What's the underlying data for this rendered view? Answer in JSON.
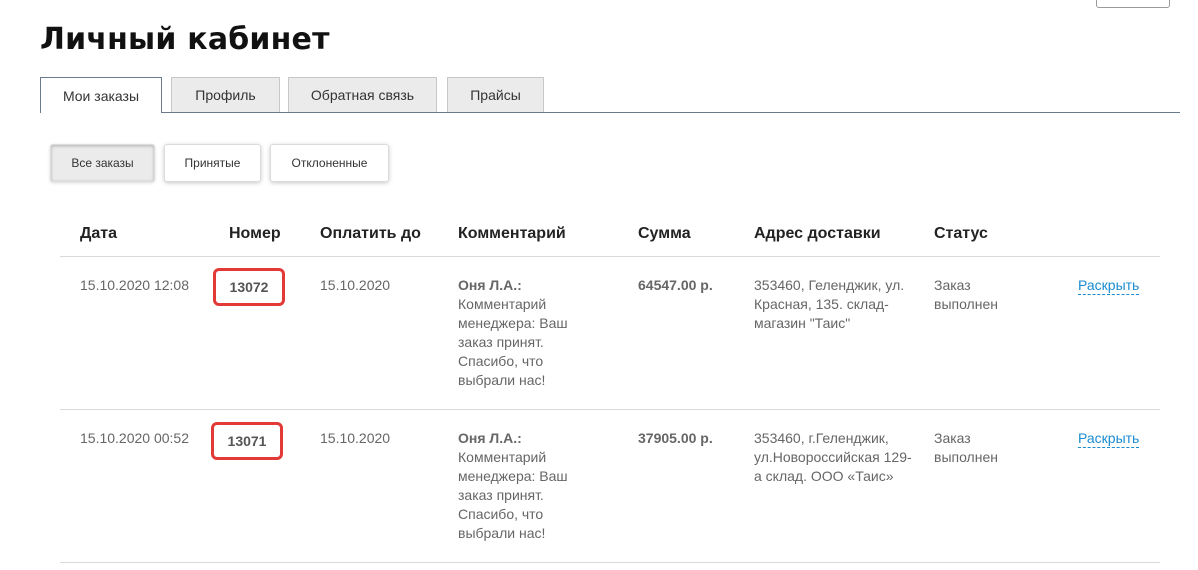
{
  "page": {
    "title": "Личный кабинет"
  },
  "tabs": [
    {
      "label": "Мои заказы",
      "active": true
    },
    {
      "label": "Профиль",
      "active": false
    },
    {
      "label": "Обратная связь",
      "active": false
    },
    {
      "label": "Прайсы",
      "active": false
    }
  ],
  "filters": [
    {
      "label": "Все заказы",
      "active": true
    },
    {
      "label": "Принятые",
      "active": false
    },
    {
      "label": "Отклоненные",
      "active": false
    }
  ],
  "table": {
    "columns": [
      "Дата",
      "Номер",
      "Оплатить до",
      "Комментарий",
      "Сумма",
      "Адрес доставки",
      "Статус"
    ],
    "rows": [
      {
        "date": "15.10.2020 12:08",
        "number": "13072",
        "pay_until": "15.10.2020",
        "comment_author": "Оня Л.А.:",
        "comment_text": "Комментарий менеджера: Ваш заказ принят. Спасибо, что выбрали нас!",
        "sum": "64547.00 р.",
        "address": "353460, Геленджик, ул. Красная, 135. склад-магазин \"Таис\"",
        "status": "Заказ выполнен",
        "action": "Раскрыть"
      },
      {
        "date": "15.10.2020 00:52",
        "number": "13071",
        "pay_until": "15.10.2020",
        "comment_author": "Оня Л.А.:",
        "comment_text": "Комментарий менеджера: Ваш заказ принят. Спасибо, что выбрали нас!",
        "sum": "37905.00 р.",
        "address": "353460, г.Геленджик, ул.Новороссийская 129-а склад. ООО «Таис»",
        "status": "Заказ выполнен",
        "action": "Раскрыть"
      }
    ]
  },
  "colors": {
    "accent_link": "#1a8ccf",
    "highlight_border": "#e23a36",
    "tab_border": "#6a7a8a"
  }
}
